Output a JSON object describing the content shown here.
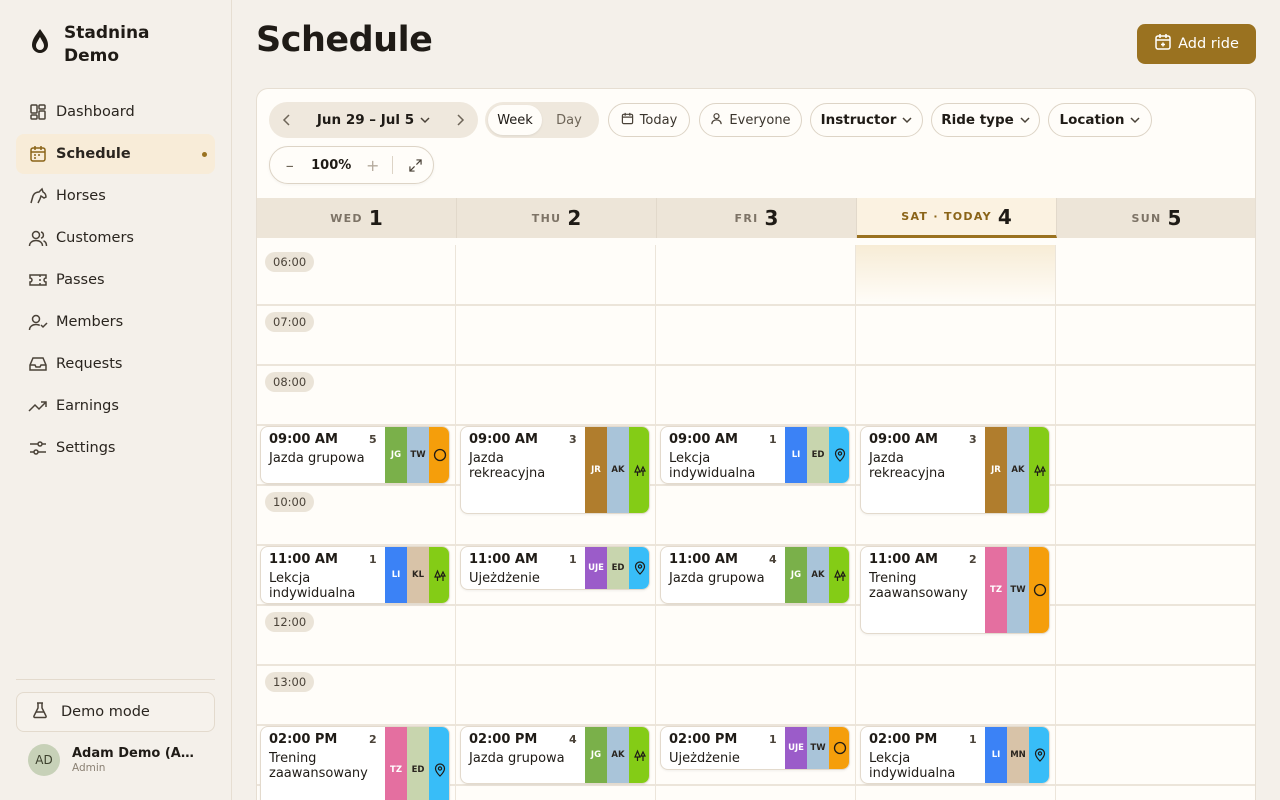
{
  "brand": {
    "name": "Stadnina Demo"
  },
  "nav": [
    {
      "label": "Dashboard",
      "icon": "dashboard-icon"
    },
    {
      "label": "Schedule",
      "icon": "calendar-icon",
      "active": true
    },
    {
      "label": "Horses",
      "icon": "horse-icon"
    },
    {
      "label": "Customers",
      "icon": "users-icon"
    },
    {
      "label": "Passes",
      "icon": "ticket-icon"
    },
    {
      "label": "Members",
      "icon": "user-check-icon"
    },
    {
      "label": "Requests",
      "icon": "inbox-icon"
    },
    {
      "label": "Earnings",
      "icon": "trend-up-icon"
    },
    {
      "label": "Settings",
      "icon": "sliders-icon"
    }
  ],
  "demo": {
    "label": "Demo mode"
  },
  "user": {
    "initials": "AD",
    "name": "Adam Demo (Admin)",
    "role": "Admin"
  },
  "header": {
    "title": "Schedule",
    "add_label": "Add ride"
  },
  "toolbar": {
    "range": "Jun 29 – Jul 5",
    "view_week": "Week",
    "view_day": "Day",
    "today": "Today",
    "everyone": "Everyone",
    "instructor": "Instructor",
    "ride_type": "Ride type",
    "location": "Location",
    "zoom": "100%"
  },
  "days": [
    {
      "name": "WED",
      "num": "1"
    },
    {
      "name": "THU",
      "num": "2"
    },
    {
      "name": "FRI",
      "num": "3"
    },
    {
      "name": "SAT · TODAY",
      "num": "4"
    },
    {
      "name": "SUN",
      "num": "5"
    }
  ],
  "times": [
    "06:00",
    "07:00",
    "08:00",
    "10:00",
    "12:00",
    "13:00"
  ],
  "colors": {
    "accent": "#9a7220"
  },
  "events": [
    {
      "day": 0,
      "slot": "09",
      "time": "09:00 AM",
      "count": "5",
      "title": "Jazda grupowa",
      "chips": [
        {
          "t": "JG",
          "c": "#7ab04a"
        },
        {
          "t": "TW",
          "c": "#a9c4d9",
          "dark": true
        },
        {
          "icon": "circle",
          "c": "#f59e0b"
        }
      ]
    },
    {
      "day": 1,
      "slot": "09",
      "time": "09:00 AM",
      "count": "3",
      "title": "Jazda rekreacyjna",
      "tall": true,
      "chips": [
        {
          "t": "JR",
          "c": "#b07d2d"
        },
        {
          "t": "AK",
          "c": "#a9c4d9",
          "dark": true
        },
        {
          "icon": "trees",
          "c": "#84cc16"
        }
      ]
    },
    {
      "day": 2,
      "slot": "09",
      "time": "09:00 AM",
      "count": "1",
      "title": "Lekcja indywidualna",
      "chips": [
        {
          "t": "LI",
          "c": "#3b82f6"
        },
        {
          "t": "ED",
          "c": "#c8d5ae",
          "dark": true
        },
        {
          "icon": "pin",
          "c": "#38bdf8"
        }
      ]
    },
    {
      "day": 3,
      "slot": "09",
      "time": "09:00 AM",
      "count": "3",
      "title": "Jazda rekreacyjna",
      "tall": true,
      "chips": [
        {
          "t": "JR",
          "c": "#b07d2d"
        },
        {
          "t": "AK",
          "c": "#a9c4d9",
          "dark": true
        },
        {
          "icon": "trees",
          "c": "#84cc16"
        }
      ]
    },
    {
      "day": 0,
      "slot": "11",
      "time": "11:00 AM",
      "count": "1",
      "title": "Lekcja indywidualna",
      "chips": [
        {
          "t": "LI",
          "c": "#3b82f6"
        },
        {
          "t": "KL",
          "c": "#d8c3a8",
          "dark": true
        },
        {
          "icon": "trees",
          "c": "#84cc16"
        }
      ]
    },
    {
      "day": 1,
      "slot": "11",
      "time": "11:00 AM",
      "count": "1",
      "title": "Ujeżdżenie",
      "short": true,
      "chips": [
        {
          "t": "UJE",
          "c": "#9b5cc9"
        },
        {
          "t": "ED",
          "c": "#c8d5ae",
          "dark": true
        },
        {
          "icon": "pin",
          "c": "#38bdf8"
        }
      ]
    },
    {
      "day": 2,
      "slot": "11",
      "time": "11:00 AM",
      "count": "4",
      "title": "Jazda grupowa",
      "chips": [
        {
          "t": "JG",
          "c": "#7ab04a"
        },
        {
          "t": "AK",
          "c": "#a9c4d9",
          "dark": true
        },
        {
          "icon": "trees",
          "c": "#84cc16"
        }
      ]
    },
    {
      "day": 3,
      "slot": "11",
      "time": "11:00 AM",
      "count": "2",
      "title": "Trening zaawansowany",
      "tall": true,
      "chips": [
        {
          "t": "TZ",
          "c": "#e46fa0"
        },
        {
          "t": "TW",
          "c": "#a9c4d9",
          "dark": true
        },
        {
          "icon": "circle",
          "c": "#f59e0b"
        }
      ]
    },
    {
      "day": 0,
      "slot": "14",
      "time": "02:00 PM",
      "count": "2",
      "title": "Trening zaawansowany",
      "tall": true,
      "chips": [
        {
          "t": "TZ",
          "c": "#e46fa0"
        },
        {
          "t": "ED",
          "c": "#c8d5ae",
          "dark": true
        },
        {
          "icon": "pin",
          "c": "#38bdf8"
        }
      ]
    },
    {
      "day": 1,
      "slot": "14",
      "time": "02:00 PM",
      "count": "4",
      "title": "Jazda grupowa",
      "chips": [
        {
          "t": "JG",
          "c": "#7ab04a"
        },
        {
          "t": "AK",
          "c": "#a9c4d9",
          "dark": true
        },
        {
          "icon": "trees",
          "c": "#84cc16"
        }
      ]
    },
    {
      "day": 2,
      "slot": "14",
      "time": "02:00 PM",
      "count": "1",
      "title": "Ujeżdżenie",
      "short": true,
      "chips": [
        {
          "t": "UJE",
          "c": "#9b5cc9"
        },
        {
          "t": "TW",
          "c": "#a9c4d9",
          "dark": true
        },
        {
          "icon": "circle",
          "c": "#f59e0b"
        }
      ]
    },
    {
      "day": 3,
      "slot": "14",
      "time": "02:00 PM",
      "count": "1",
      "title": "Lekcja indywidualna",
      "chips": [
        {
          "t": "LI",
          "c": "#3b82f6"
        },
        {
          "t": "MN",
          "c": "#d8c3a8",
          "dark": true
        },
        {
          "icon": "pin",
          "c": "#38bdf8"
        }
      ]
    }
  ]
}
